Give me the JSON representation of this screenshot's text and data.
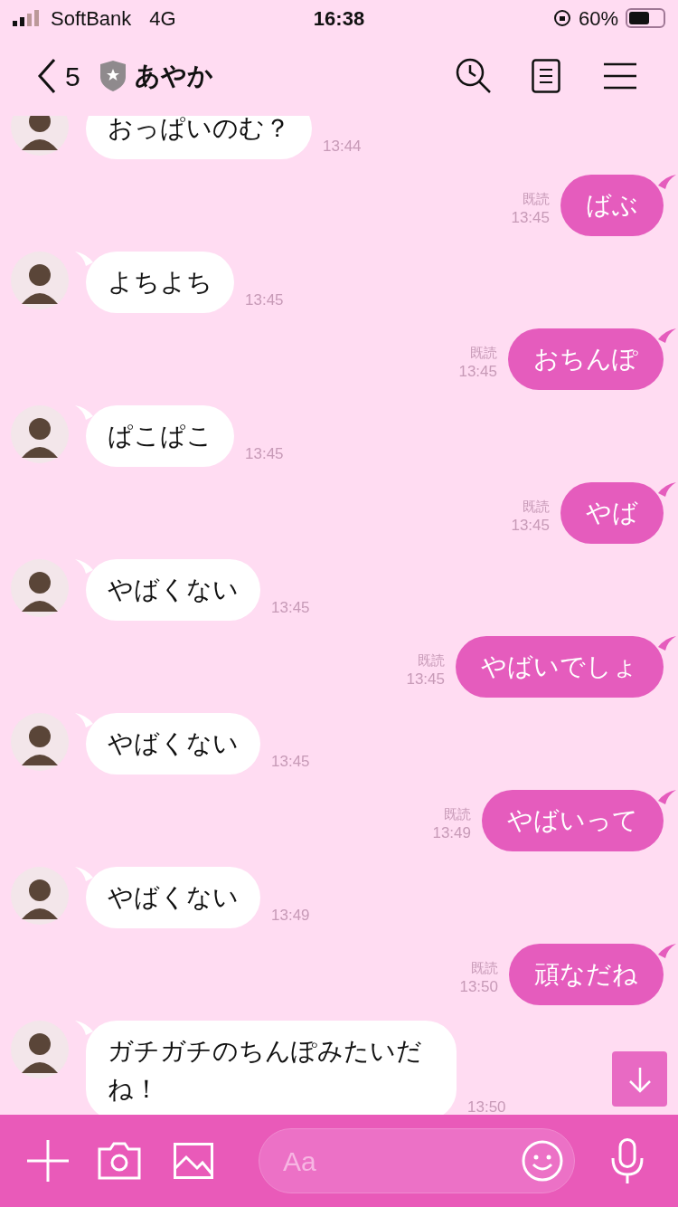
{
  "status_bar": {
    "carrier": "SoftBank",
    "network": "4G",
    "time": "16:38",
    "battery": "60%"
  },
  "header": {
    "back_count": "5",
    "title": "あやか"
  },
  "messages": [
    {
      "kind": "received",
      "text": "おっぱいのむ？",
      "time": "13:44"
    },
    {
      "kind": "sent",
      "text": "ばぶ",
      "time": "13:45",
      "read_label": "既読"
    },
    {
      "kind": "received",
      "text": "よちよち",
      "time": "13:45"
    },
    {
      "kind": "sent",
      "text": "おちんぽ",
      "time": "13:45",
      "read_label": "既読"
    },
    {
      "kind": "received",
      "text": "ぱこぱこ",
      "time": "13:45"
    },
    {
      "kind": "sent",
      "text": "やば",
      "time": "13:45",
      "read_label": "既読"
    },
    {
      "kind": "received",
      "text": "やばくない",
      "time": "13:45"
    },
    {
      "kind": "sent",
      "text": "やばいでしょ",
      "time": "13:45",
      "read_label": "既読"
    },
    {
      "kind": "received",
      "text": "やばくない",
      "time": "13:45"
    },
    {
      "kind": "sent",
      "text": "やばいって",
      "time": "13:49",
      "read_label": "既読"
    },
    {
      "kind": "received",
      "text": "やばくない",
      "time": "13:49"
    },
    {
      "kind": "sent",
      "text": "頑なだね",
      "time": "13:50",
      "read_label": "既読"
    },
    {
      "kind": "received",
      "text": "ガチガチのちんぽみたいだね！",
      "time": "13:50"
    }
  ],
  "input": {
    "placeholder": "Aa"
  }
}
